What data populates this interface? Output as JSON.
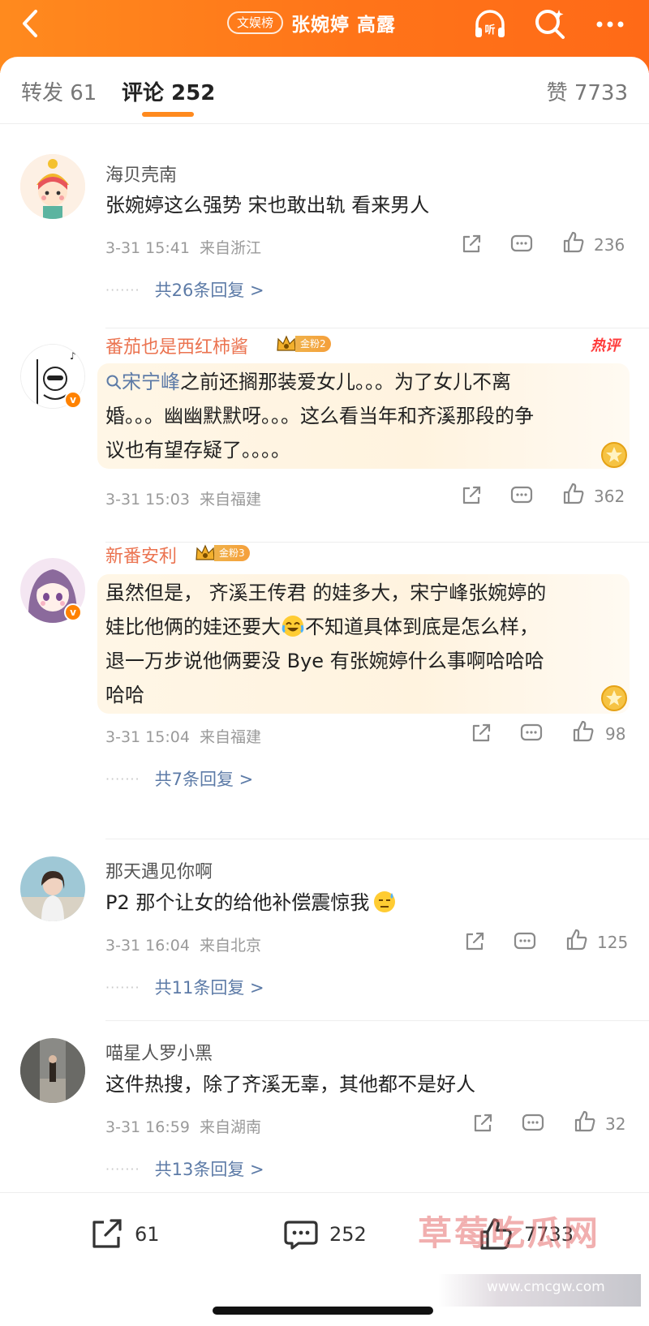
{
  "header": {
    "back_icon": "chevron-left-icon",
    "badge": "文娱榜",
    "title": "张婉婷 高露",
    "listen_label": "听",
    "listen_icon": "headphones-icon",
    "search_icon": "search-icon",
    "more_icon": "more-icon",
    "gradient_start": "#ff8a1e",
    "gradient_end": "#ff6a17"
  },
  "tabs": {
    "repost": "转发 61",
    "comment": "评论 252",
    "like": "赞 7733",
    "accent": "#ff8a1e"
  },
  "comments": [
    {
      "user": "海贝壳南",
      "text": "张婉婷这么强势 宋也敢出轨 看来男人",
      "time": "3-31 15:41",
      "location": "来自浙江",
      "likes": "236",
      "replies": "共26条回复 >"
    },
    {
      "user": "番茄也是西红柿酱",
      "fan_level": "金粉2",
      "hot_label": "热评",
      "link": "宋宁峰",
      "text_line1_rest": "之前还搁那装爱女儿。。。为了女儿不离",
      "text_line2": "婚。。。幽幽默默呀。。。这么看当年和齐溪那段的争",
      "text_line3": "议也有望存疑了。。。。",
      "time": "3-31 15:03",
      "location": "来自福建",
      "likes": "362"
    },
    {
      "user": "新番安利",
      "fan_level": "金粉3",
      "text_line1": "虽然但是， 齐溪王传君 的娃多大，宋宁峰张婉婷的",
      "text_line2a": "娃比他俩的娃还要大",
      "text_line2b": "不知道具体到底是怎么样，",
      "text_line3": "退一万步说他俩要没 Bye 有张婉婷什么事啊哈哈哈",
      "text_line4": "哈哈",
      "time": "3-31 15:04",
      "location": "来自福建",
      "likes": "98",
      "replies": "共7条回复 >"
    },
    {
      "user": "那天遇见你啊",
      "text": "P2 那个让女的给他补偿震惊我",
      "time": "3-31 16:04",
      "location": "来自北京",
      "likes": "125",
      "replies": "共11条回复 >"
    },
    {
      "user": "喵星人罗小黑",
      "text": "这件热搜，除了齐溪无辜，其他都不是好人",
      "time": "3-31 16:59",
      "location": "来自湖南",
      "likes": "32",
      "replies": "共13条回复 >"
    }
  ],
  "reply_dots": "·······",
  "bottom": {
    "repost_count": "61",
    "comment_count": "252",
    "like_count": "7733"
  },
  "watermark": {
    "text": "草莓吃瓜网",
    "url": "www.cmcgw.com"
  },
  "colors": {
    "link": "#5d7ba7",
    "hot_name": "#eb7350",
    "meta": "#9a9a9a"
  }
}
